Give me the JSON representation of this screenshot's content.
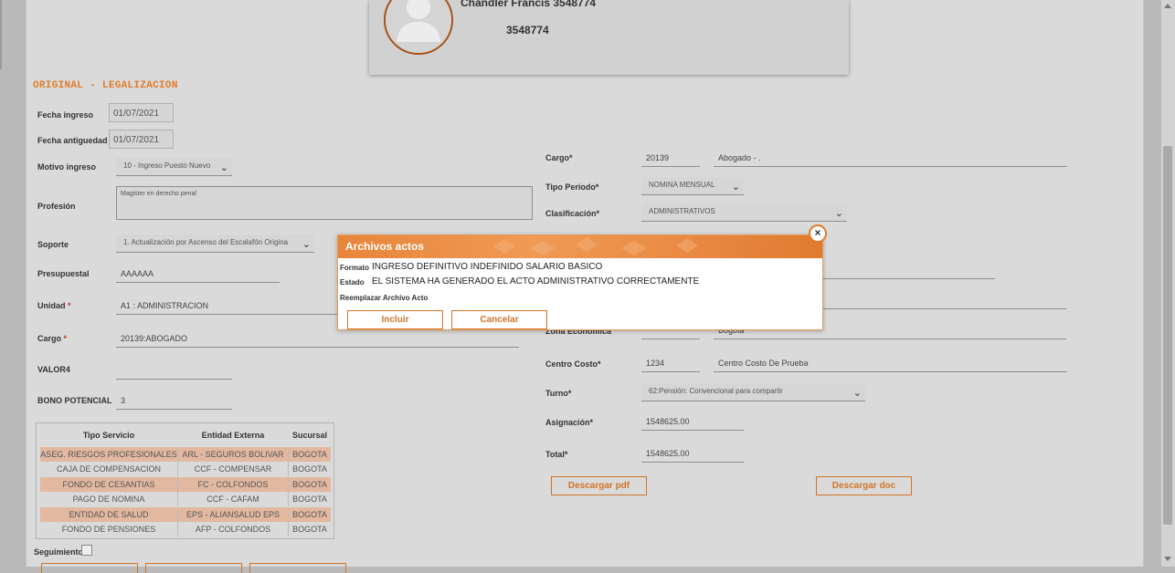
{
  "profile": {
    "name": "Chandler Francis 3548774",
    "id": "3548774"
  },
  "section_title": "ORIGINAL - LEGALIZACION",
  "left_form": {
    "fecha_ingreso": {
      "label": "Fecha ingreso",
      "value": "01/07/2021"
    },
    "fecha_antiguedad": {
      "label": "Fecha antiguedad",
      "value": "01/07/2021"
    },
    "motivo_ingreso": {
      "label": "Motivo ingreso",
      "value": "10 - Ingreso Puesto Nuevo"
    },
    "profesion": {
      "label": "Profesión",
      "value": "Magister en derecho penal"
    },
    "soporte": {
      "label": "Soporte",
      "value": "1. Actualización por Ascenso del Escalafón Origina"
    },
    "presupuestal": {
      "label": "Presupuestal",
      "value": "AAAAAA"
    },
    "unidad": {
      "label": "Unidad",
      "value": "A1 : ADMINISTRACION"
    },
    "cargo": {
      "label": "Cargo",
      "value": "20139:ABOGADO"
    },
    "valor4": {
      "label": "VALOR4",
      "value": ""
    },
    "bono_potencial": {
      "label": "BONO POTENCIAL",
      "value": "3"
    },
    "seguimiento": {
      "label": "Seguimiento"
    }
  },
  "required_mark": "*",
  "services_table": {
    "headers": [
      "Tipo Servicio",
      "Entidad Externa",
      "Sucursal"
    ],
    "rows": [
      [
        "ASEG. RIESGOS PROFESIONALES",
        "ARL - SEGUROS BOLIVAR",
        "BOGOTA"
      ],
      [
        "CAJA DE COMPENSACION",
        "CCF - COMPENSAR",
        "BOGOTA"
      ],
      [
        "FONDO DE CESANTIAS",
        "FC - COLFONDOS",
        "BOGOTA"
      ],
      [
        "PAGO DE NOMINA",
        "CCF - CAFAM",
        "BOGOTA"
      ],
      [
        "ENTIDAD DE SALUD",
        "EPS - ALIANSALUD EPS",
        "BOGOTA"
      ],
      [
        "FONDO DE PENSIONES",
        "AFP - COLFONDOS",
        "BOGOTA"
      ]
    ]
  },
  "right_form": {
    "cargo": {
      "label": "Cargo*",
      "code": "20139",
      "desc": "Abogado - ."
    },
    "tipo_periodo": {
      "label": "Tipo Periodo*",
      "value": "NOMINA MENSUAL"
    },
    "clasificacion": {
      "label": "Clasificación*",
      "value": "ADMINISTRATIVOS"
    },
    "zona_economica": {
      "label": "Zona Económica",
      "desc": "Bogotá"
    },
    "centro_costo": {
      "label": "Centro Costo*",
      "code": "1234",
      "desc": "Centro Costo De Prueba"
    },
    "turno": {
      "label": "Turno*",
      "value": "62:Pensión: Convencional para compartir"
    },
    "asignacion": {
      "label": "Asignación*",
      "value": "1548625.00"
    },
    "total": {
      "label": "Total*",
      "value": "1548625.00"
    },
    "descargar_pdf": "Descargar pdf",
    "descargar_doc": "Descargar doc"
  },
  "modal": {
    "title": "Archivos actos",
    "formato_label": "Formato",
    "formato_value": "INGRESO DEFINITIVO INDEFINIDO SALARIO BASICO",
    "estado_label": "Estado",
    "estado_value": "EL SISTEMA HA GENERADO EL ACTO ADMINISTRATIVO CORRECTAMENTE",
    "reemplazar_label": "Reemplazar Archivo Acto",
    "incluir": "Incluir",
    "cancelar": "Cancelar",
    "close_glyph": "×"
  },
  "colors": {
    "accent": "#e07d2a",
    "highlight_row": "#e2b8a0",
    "panel": "#dadada"
  },
  "icons": [
    "user-avatar-icon",
    "chevron-down-icon",
    "close-icon",
    "checkbox-icon"
  ]
}
